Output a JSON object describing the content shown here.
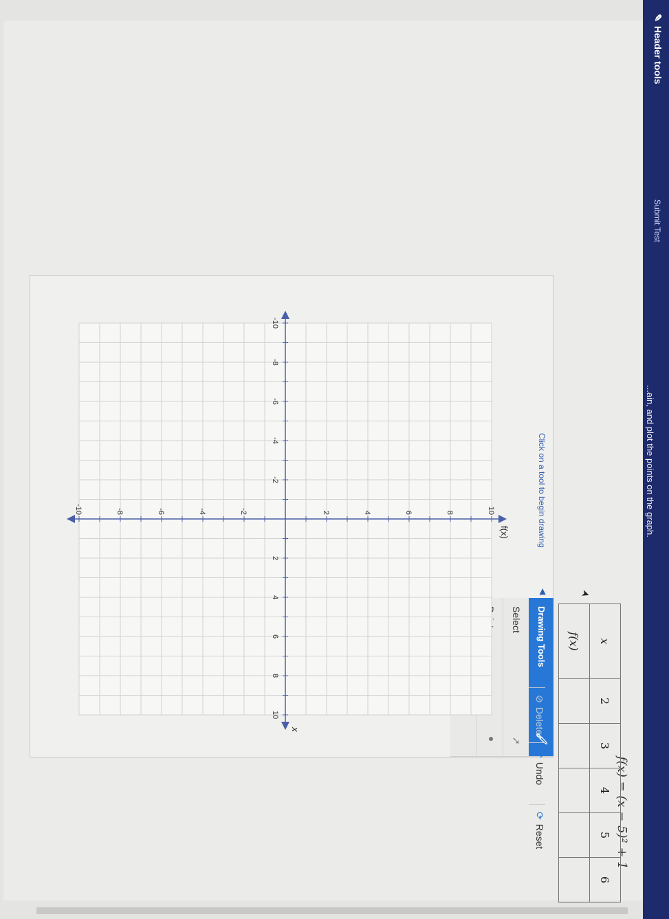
{
  "topbar": {
    "header_tools": "Header tools",
    "submit_text": "Submit Test",
    "instruction": "...ain, and plot the points on the graph."
  },
  "function_label": "f(x) = (x − 5)² + 1",
  "table": {
    "x_header": "x",
    "fx_header": "f(x)",
    "x_values": [
      "2",
      "3",
      "4",
      "5",
      "6"
    ],
    "fx_values": [
      "",
      "",
      "",
      "",
      ""
    ]
  },
  "drawing_tools": {
    "title": "Drawing Tools",
    "items": [
      "Select",
      "Point"
    ]
  },
  "hint": "Click on a tool to begin drawing",
  "toolbar": {
    "delete": "Delete",
    "undo": "Undo",
    "reset": "Reset"
  },
  "icons": {
    "brush": "paintbrush-icon",
    "select": "cursor-icon",
    "undo": "undo-icon",
    "reset": "refresh-icon"
  },
  "chart_data": {
    "type": "scatter",
    "xlabel": "x",
    "ylabel": "f(x)",
    "xlim": [
      -10,
      10
    ],
    "ylim": [
      -10,
      10
    ],
    "x_ticks": [
      -10,
      -8,
      -6,
      -4,
      -2,
      2,
      4,
      6,
      8,
      10
    ],
    "y_ticks": [
      -10,
      -8,
      -6,
      -4,
      -2,
      2,
      4,
      6,
      8,
      10
    ],
    "grid": true,
    "points": []
  },
  "colors": {
    "accent": "#2778d6",
    "topbar": "#1d2a6b",
    "axis": "#4a5fa8"
  }
}
